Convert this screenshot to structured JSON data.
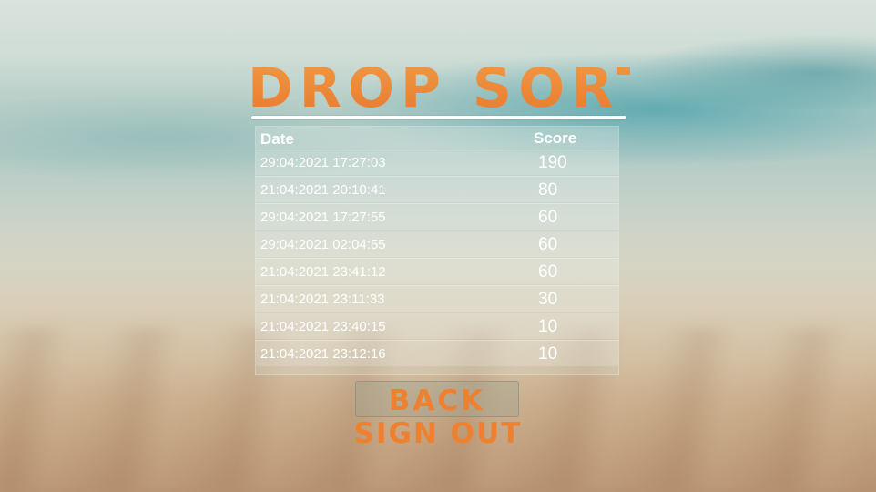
{
  "title": "DROP SORT",
  "table": {
    "headers": {
      "date": "Date",
      "score": "Score"
    },
    "rows": [
      {
        "date": "29:04:2021 17:27:03",
        "score": "190"
      },
      {
        "date": "21:04:2021 20:10:41",
        "score": "80"
      },
      {
        "date": "29:04:2021 17:27:55",
        "score": "60"
      },
      {
        "date": "29:04:2021 02:04:55",
        "score": "60"
      },
      {
        "date": "21:04:2021 23:41:12",
        "score": "60"
      },
      {
        "date": "21:04:2021 23:11:33",
        "score": "30"
      },
      {
        "date": "21:04:2021 23:40:15",
        "score": "10"
      },
      {
        "date": "21:04:2021 23:12:16",
        "score": "10"
      }
    ]
  },
  "buttons": {
    "back": "BACK",
    "sign_out": "SIGN OUT"
  },
  "colors": {
    "accent": "#ee8130",
    "text": "#ffffff"
  }
}
